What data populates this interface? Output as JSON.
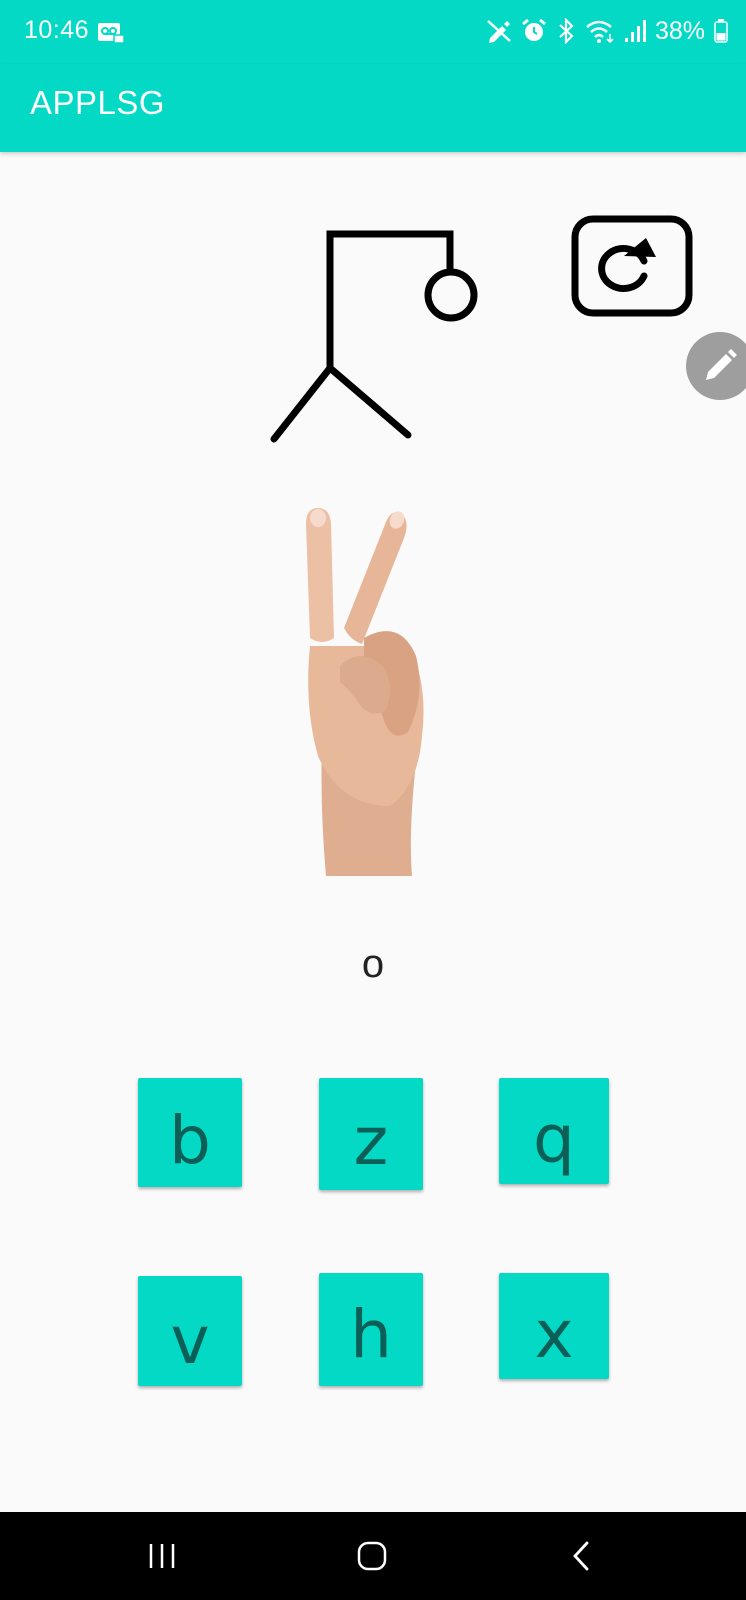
{
  "status_bar": {
    "time": "10:46",
    "battery": "38%",
    "icons": [
      "voicemail-icon",
      "pen-off-icon",
      "alarm-icon",
      "bluetooth-icon",
      "wifi-icon",
      "signal-icon",
      "battery-icon"
    ]
  },
  "app_bar": {
    "title": "APPLSG"
  },
  "game": {
    "restart_icon": "restart-icon",
    "edit_icon": "pencil-icon",
    "sign_image": "hand-sign-v-image",
    "current_letter": "o",
    "choices": [
      "b",
      "z",
      "q",
      "v",
      "h",
      "x"
    ]
  },
  "nav_bar": {
    "icons": [
      "recent-apps-icon",
      "home-icon",
      "back-icon"
    ]
  },
  "colors": {
    "accent": "#03d9c5",
    "button_text": "#0c5f57",
    "fab": "#9e9e9e"
  }
}
